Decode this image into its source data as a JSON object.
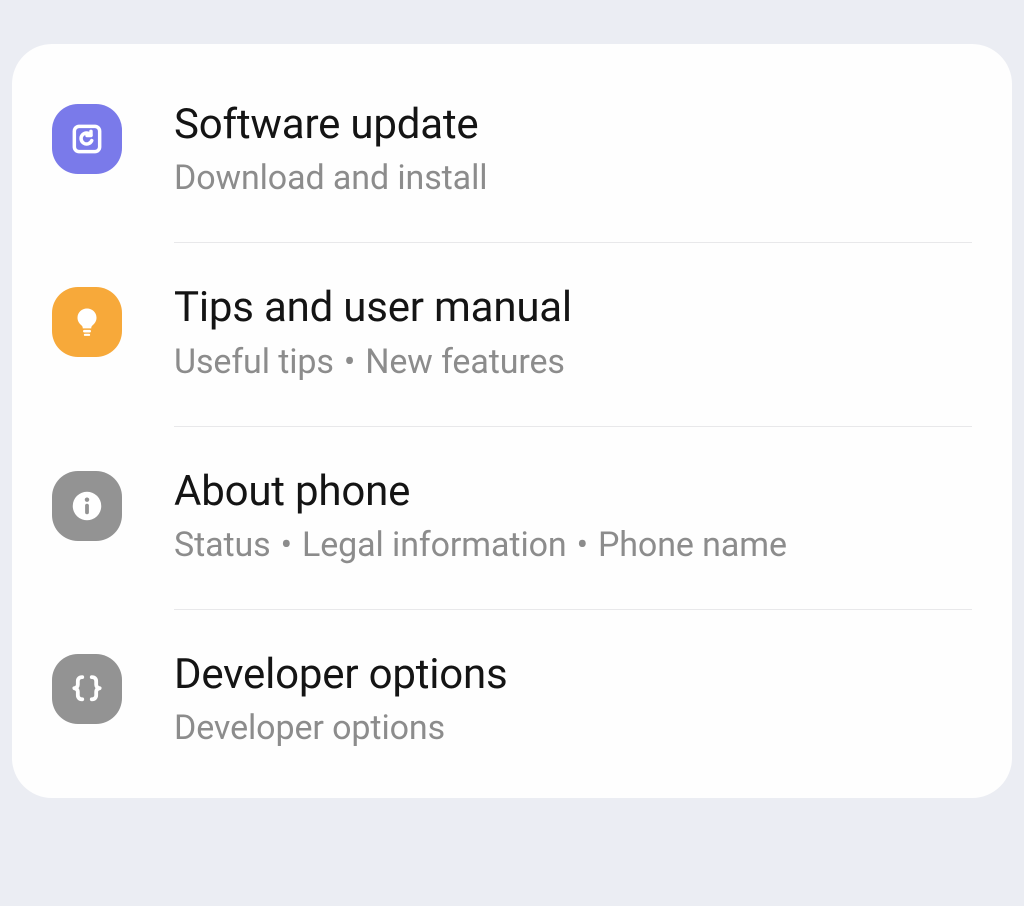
{
  "settings": {
    "items": [
      {
        "title": "Software update",
        "subtitle_parts": [
          "Download and install"
        ],
        "icon_color": "icon-purple"
      },
      {
        "title": "Tips and user manual",
        "subtitle_parts": [
          "Useful tips",
          "New features"
        ],
        "icon_color": "icon-orange"
      },
      {
        "title": "About phone",
        "subtitle_parts": [
          "Status",
          "Legal information",
          "Phone name"
        ],
        "icon_color": "icon-gray"
      },
      {
        "title": "Developer options",
        "subtitle_parts": [
          "Developer options"
        ],
        "icon_color": "icon-gray"
      }
    ]
  }
}
